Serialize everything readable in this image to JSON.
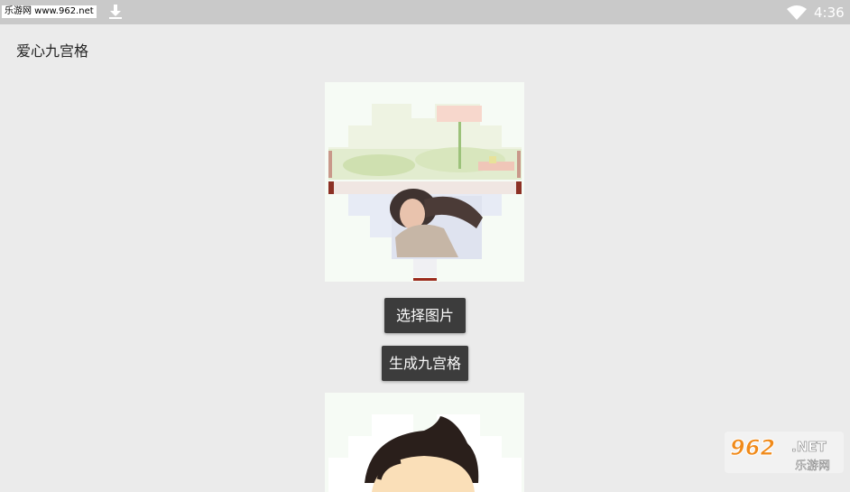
{
  "status_bar": {
    "watermark": "乐游网 www.962.net",
    "time": "4:36",
    "icons": [
      "download-icon",
      "wifi-icon"
    ]
  },
  "app": {
    "title": "爱心九宫格"
  },
  "buttons": {
    "select_image": "选择图片",
    "generate_grid": "生成九宫格"
  },
  "logo": {
    "text": "962.NET 乐游网"
  },
  "colors": {
    "status_bar": "#c9c9c9",
    "background": "#ebebeb",
    "button": "#3c3c3c",
    "logo_orange": "#f08a1a"
  }
}
